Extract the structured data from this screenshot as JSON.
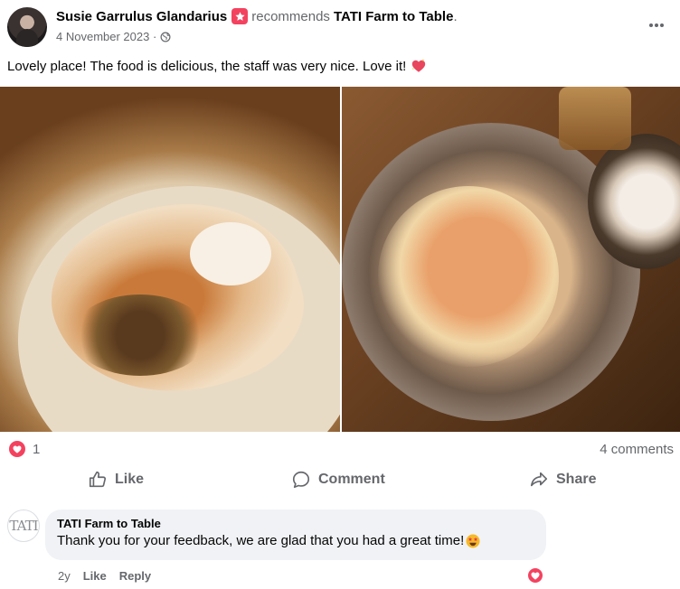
{
  "post": {
    "author": "Susie Garrulus Glandarius",
    "recommend_verb": "recommends",
    "page_name": "TATI Farm to Table",
    "period": ".",
    "date": "4 November 2023 ·",
    "audience_icon": "globe-icon",
    "caption": "Lovely place! The food is delicious, the staff was very nice. Love it!",
    "caption_emoji": "sparkling-heart"
  },
  "photos": [
    {
      "name": "photo-left",
      "alt": "food-plate"
    },
    {
      "name": "photo-right",
      "alt": "food-bowl"
    }
  ],
  "stats": {
    "reaction": "love",
    "reaction_count": "1",
    "comments": "4 comments"
  },
  "actions": {
    "like": "Like",
    "comment": "Comment",
    "share": "Share"
  },
  "comment": {
    "author": "TATI Farm to Table",
    "avatar_text": "TATI",
    "text": "Thank you for your feedback, we are glad that you had a great time!",
    "emoji": "star-struck",
    "age": "2y",
    "like": "Like",
    "reply": "Reply",
    "reaction": "love"
  },
  "colors": {
    "love_red": "#f3425f",
    "secondary_text": "#65676b",
    "bubble": "#f0f2f5"
  }
}
